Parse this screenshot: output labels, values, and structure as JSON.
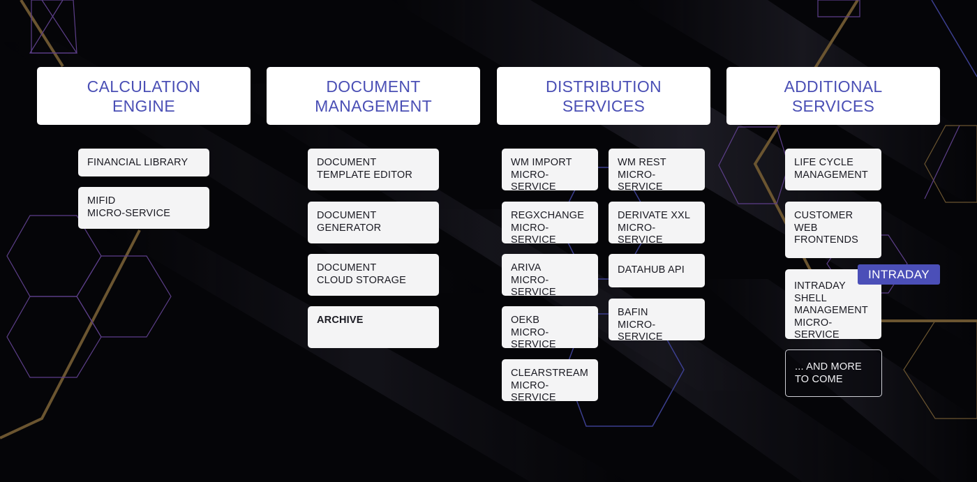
{
  "colors": {
    "background": "#050508",
    "header_text": "#4a4fb5",
    "card_bg": "#f4f4f5",
    "card_text": "#1a1a22",
    "badge_bg": "#4b4fb8",
    "gold_line": "#6b5530",
    "purple_line": "#6a4a9a",
    "blue_line": "#3c3f8f"
  },
  "columns": [
    {
      "title": "CALCULATION\nENGINE",
      "items": [
        {
          "label": "FINANCIAL LIBRARY"
        },
        {
          "label": "MIFID\nMICRO-SERVICE"
        }
      ]
    },
    {
      "title": "DOCUMENT\nMANAGEMENT",
      "items": [
        {
          "label": "DOCUMENT\nTEMPLATE EDITOR"
        },
        {
          "label": "DOCUMENT\nGENERATOR"
        },
        {
          "label": "DOCUMENT\nCLOUD STORAGE"
        },
        {
          "label": "ARCHIVE"
        }
      ]
    },
    {
      "title": "DISTRIBUTION\nSERVICES",
      "items": [
        {
          "label": "WM IMPORT\nMICRO-SERVICE"
        },
        {
          "label": "REGXCHANGE\nMICRO-SERVICE"
        },
        {
          "label": "ARIVA\nMICRO-SERVICE"
        },
        {
          "label": "OEKB\nMICRO-SERVICE"
        },
        {
          "label": "CLEARSTREAM\nMICRO-SERVICE"
        },
        {
          "label": "WM REST\nMICRO-SERVICE"
        },
        {
          "label": "DERIVATE XXL\nMICRO-SERVICE"
        },
        {
          "label": "DATAHUB API"
        },
        {
          "label": "BAFIN\nMICRO-SERVICE"
        }
      ]
    },
    {
      "title": "ADDITIONAL\nSERVICES",
      "items": [
        {
          "label": "LIFE CYCLE\nMANAGEMENT"
        },
        {
          "label": "CUSTOMER\nWEB\nFRONTENDS"
        },
        {
          "label": "INTRADAY\nSHELL\nMANAGEMENT\nMICRO-SERVICE"
        },
        {
          "label": "... AND MORE\nTO COME"
        }
      ],
      "badge": "INTRADAY"
    }
  ]
}
